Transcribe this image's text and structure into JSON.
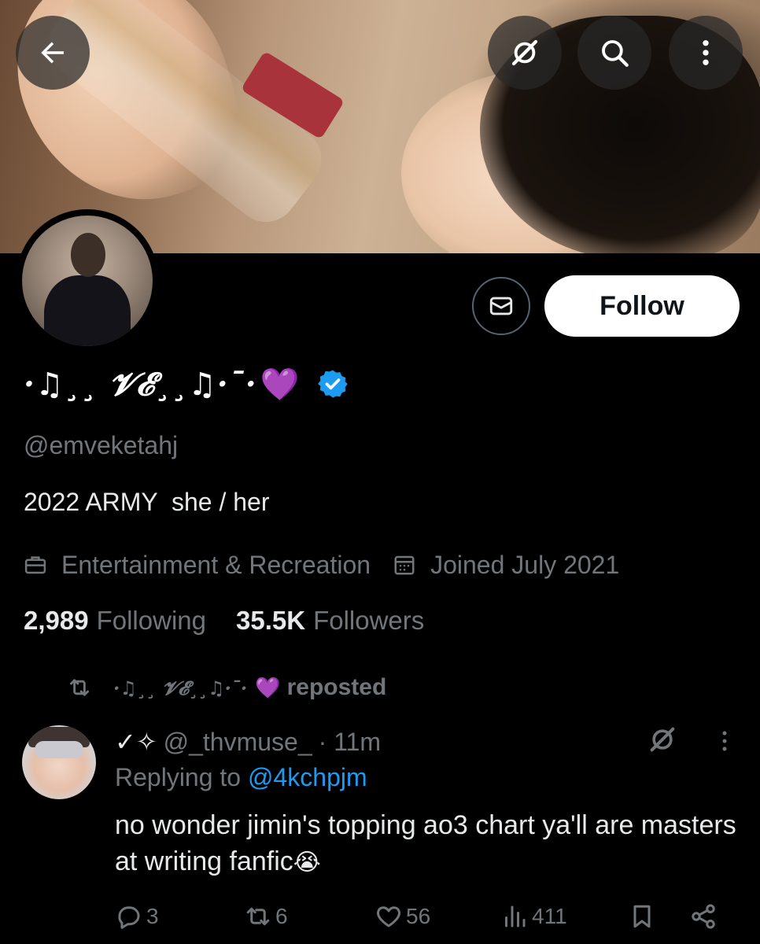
{
  "colors": {
    "background": "#000000",
    "accent": "#1d9bf0",
    "heart": "#a64bff",
    "muted": "#71767b"
  },
  "profile": {
    "display_name": "·♫¸¸ 𝓥𝓔¸¸♫·¯·",
    "heart": "💜",
    "verified": true,
    "handle": "@emveketahj",
    "bio": "2022 ARMY  she / her",
    "category": "Entertainment & Recreation",
    "joined": "Joined July 2021",
    "following_count": "2,989",
    "following_label": "Following",
    "followers_count": "35.5K",
    "followers_label": "Followers"
  },
  "buttons": {
    "follow_label": "Follow"
  },
  "icons": {
    "back": "arrow-left-icon",
    "grok": "grok-icon",
    "search": "search-icon",
    "more": "more-vertical-icon",
    "message": "envelope-icon"
  },
  "tweet": {
    "repost_by": "·♫¸¸ 𝓥𝓔¸¸♫·¯·",
    "repost_heart": "💜",
    "repost_label": "reposted",
    "author_display": "✓✧",
    "author_handle": "@_thvmuse_",
    "time": "· 11m",
    "replying_label": "Replying to",
    "replying_to": "@4kchpjm",
    "text": "no wonder jimin's topping ao3 chart ya'll are masters at writing fanfic",
    "text_emoji": "😭",
    "replies": "3",
    "reposts": "6",
    "likes": "56",
    "views": "411"
  }
}
